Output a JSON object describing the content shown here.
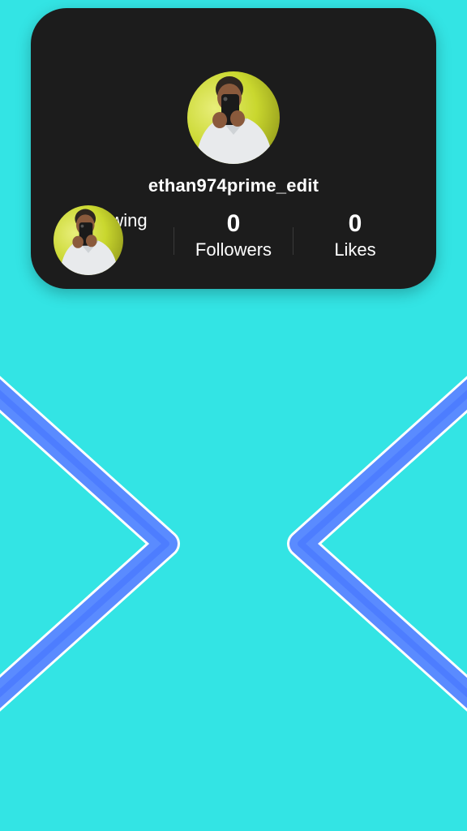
{
  "profile": {
    "username": "ethan974prime_edit",
    "avatar_icon": "profile-photo",
    "stats": [
      {
        "value": "",
        "label": "wing"
      },
      {
        "value": "0",
        "label": "Followers"
      },
      {
        "value": "0",
        "label": "Likes"
      }
    ]
  },
  "decor": {
    "background_color": "#33e4e4",
    "card_color": "#1c1c1c",
    "chevron_color": "#5a8bff",
    "left_arrow_icon": "chevron-left-icon",
    "right_arrow_icon": "chevron-right-icon"
  }
}
